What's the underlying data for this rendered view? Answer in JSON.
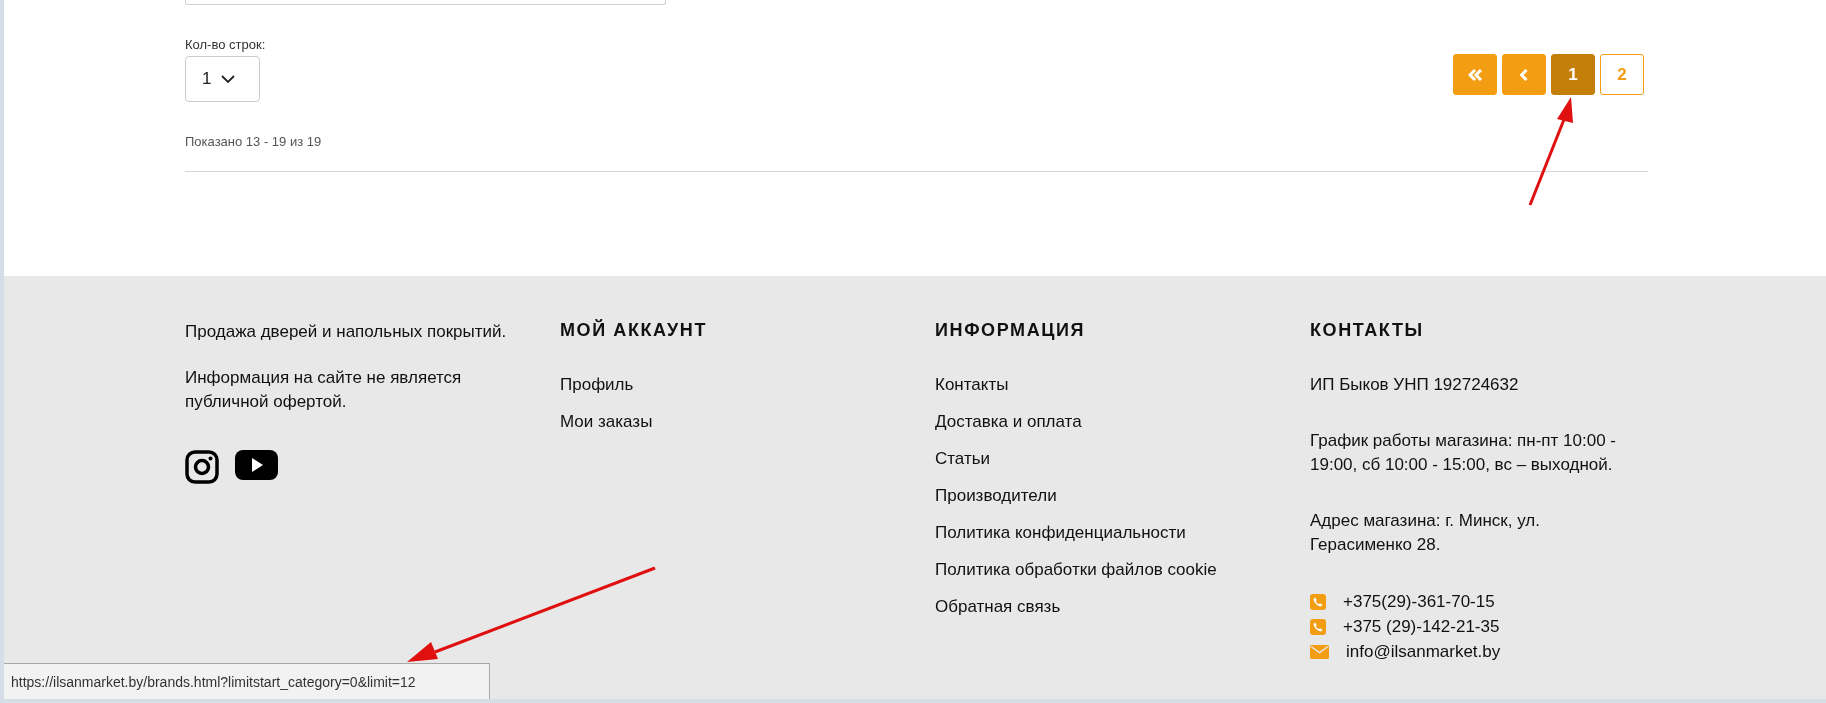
{
  "rows_select": {
    "label": "Кол-во строк:",
    "value": "1"
  },
  "shown_text": "Показано 13 - 19 из 19",
  "pagination": [
    {
      "kind": "first",
      "selected": false
    },
    {
      "kind": "prev",
      "selected": false
    },
    {
      "kind": "page",
      "label": "1",
      "selected": true
    },
    {
      "kind": "page",
      "label": "2",
      "selected": false
    }
  ],
  "footer": {
    "about": [
      "Продажа дверей и напольных покрытий.",
      "Информация на сайте не является публичной офертой."
    ],
    "social": [
      {
        "kind": "instagram"
      },
      {
        "kind": "youtube"
      }
    ],
    "account": {
      "title": "МОЙ АККАУНТ",
      "links": [
        "Профиль",
        "Мои заказы"
      ]
    },
    "info": {
      "title": "ИНФОРМАЦИЯ",
      "links": [
        "Контакты",
        "Доставка и оплата",
        "Статьи",
        "Производители",
        "Политика конфиденциальности",
        "Политика обработки файлов cookie",
        "Обратная связь"
      ]
    },
    "contacts": {
      "title": "КОНТАКТЫ",
      "paragraphs": [
        "ИП Быков УНП 192724632",
        "График работы магазина: пн-пт 10:00 - 19:00, сб 10:00 - 15:00, вс – выходной.",
        "Адрес магазина: г. Минск, ул. Герасименко 28."
      ],
      "items": [
        {
          "kind": "phone",
          "text": "+375(29)-361-70-15"
        },
        {
          "kind": "phone",
          "text": "+375 (29)-142-21-35"
        },
        {
          "kind": "email",
          "text": "info@ilsanmarket.by"
        }
      ]
    }
  },
  "status_url": "https://ilsanmarket.by/brands.html?limitstart_category=0&limit=12"
}
